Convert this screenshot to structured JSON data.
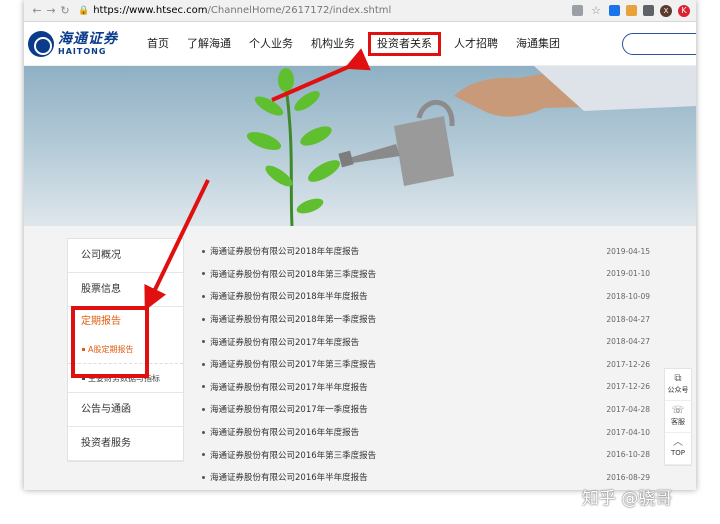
{
  "browser": {
    "url_domain": "https://www.htsec.com",
    "url_path": "/ChannelHome/2617172/index.shtml",
    "profile_initial": "X",
    "menu_initial": "K"
  },
  "header": {
    "logo_cn": "海通证券",
    "logo_en": "HAITONG",
    "nav": [
      "首页",
      "了解海通",
      "个人业务",
      "机构业务",
      "投资者关系",
      "人才招聘",
      "海通集团"
    ]
  },
  "sidebar": {
    "items": [
      "公司概况",
      "股票信息",
      "定期报告"
    ],
    "subitems": [
      "A股定期报告",
      "主要财务数据与指标"
    ],
    "bottom_items": [
      "公告与通函",
      "投资者服务"
    ]
  },
  "reports": [
    {
      "title": "海通证券股份有限公司2018年年度报告",
      "date": "2019-04-15"
    },
    {
      "title": "海通证券股份有限公司2018年第三季度报告",
      "date": "2019-01-10"
    },
    {
      "title": "海通证券股份有限公司2018年半年度报告",
      "date": "2018-10-09"
    },
    {
      "title": "海通证券股份有限公司2018年第一季度报告",
      "date": "2018-04-27"
    },
    {
      "title": "海通证券股份有限公司2017年年度报告",
      "date": "2018-04-27"
    },
    {
      "title": "海通证券股份有限公司2017年第三季度报告",
      "date": "2017-12-26"
    },
    {
      "title": "海通证券股份有限公司2017年半年度报告",
      "date": "2017-12-26"
    },
    {
      "title": "海通证券股份有限公司2017年一季度报告",
      "date": "2017-04-28"
    },
    {
      "title": "海通证券股份有限公司2016年年度报告",
      "date": "2017-04-10"
    },
    {
      "title": "海通证券股份有限公司2016年第三季度报告",
      "date": "2016-10-28"
    },
    {
      "title": "海通证券股份有限公司2016年半年度报告",
      "date": "2016-08-29"
    }
  ],
  "float_bar": [
    "公众号",
    "客服",
    "TOP"
  ],
  "watermark": "知乎 @骁哥",
  "colors": {
    "brand_blue": "#0b3c8c",
    "highlight_red": "#e01010",
    "active_orange": "#e35c10"
  }
}
